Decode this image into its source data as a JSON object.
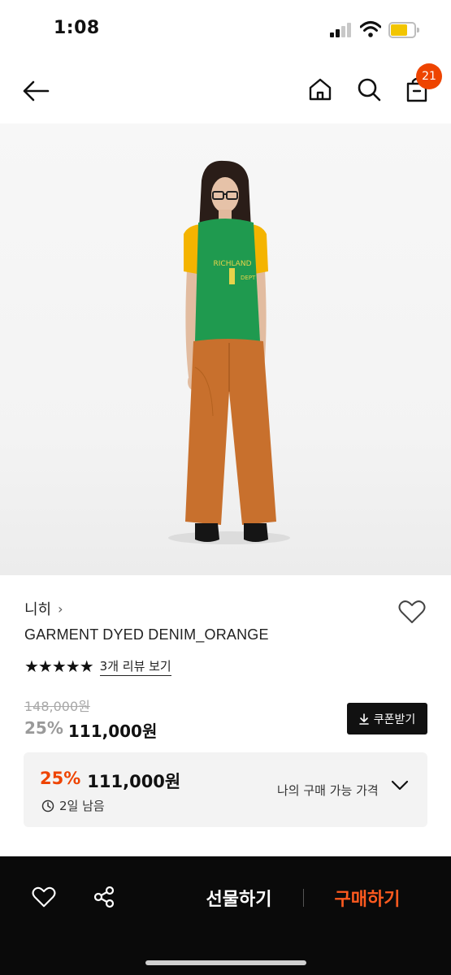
{
  "status_bar": {
    "time": "1:08"
  },
  "header": {
    "cart_count": "21"
  },
  "product": {
    "brand": "니히",
    "brand_chevron": "›",
    "name": "GARMENT DYED DENIM_ORANGE",
    "stars": "★★★★★",
    "review_link": "3개 리뷰 보기",
    "original_price": "148,000원",
    "discount_pct": "25%",
    "sale_price": "111,000원",
    "coupon_label": "쿠폰받기"
  },
  "my_price": {
    "discount_pct": "25%",
    "price": "111,000원",
    "time_left": "2일 남음",
    "label": "나의 구매 가능 가격"
  },
  "bottom_bar": {
    "gift_label": "선물하기",
    "buy_label": "구매하기"
  },
  "colors": {
    "accent": "#ee4400",
    "buy": "#ff5a1f",
    "shirt": "#1f9a4f",
    "sleeve": "#f4b400",
    "pants": "#c8702d"
  },
  "icons": {
    "back": "arrow-left-icon",
    "home": "home-icon",
    "search": "search-icon",
    "cart": "shopping-bag-icon",
    "like": "heart-icon",
    "share": "share-icon",
    "download": "download-icon",
    "clock": "clock-icon",
    "chevron": "chevron-down-icon"
  }
}
